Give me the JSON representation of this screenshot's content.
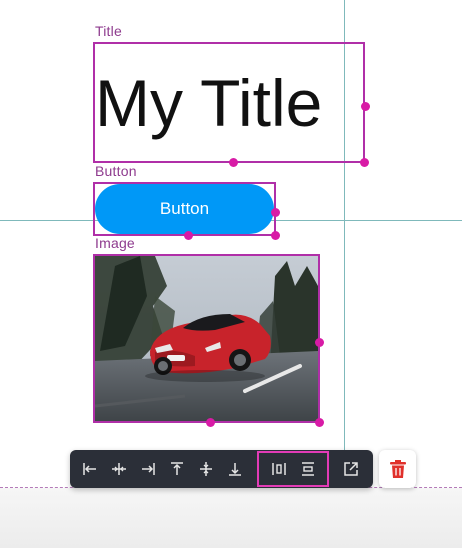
{
  "elements": {
    "title": {
      "label": "Title",
      "text": "My Title"
    },
    "button": {
      "label": "Button",
      "text": "Button"
    },
    "image": {
      "label": "Image",
      "subject": "red sports car on road"
    }
  },
  "toolbar": {
    "buttons": [
      {
        "icon": "align-left-icon"
      },
      {
        "icon": "align-horizontal-center-icon"
      },
      {
        "icon": "align-right-icon"
      },
      {
        "icon": "align-top-icon"
      },
      {
        "icon": "align-vertical-center-icon"
      },
      {
        "icon": "align-bottom-icon"
      },
      {
        "icon": "distribute-horizontal-icon"
      },
      {
        "icon": "distribute-vertical-icon"
      },
      {
        "icon": "open-external-icon"
      }
    ],
    "delete": {
      "icon": "trash-icon"
    }
  },
  "colors": {
    "selection": "#b02fa8",
    "handle": "#d81ba6",
    "guide": "#7fb9bb",
    "button_bg": "#0098f7",
    "toolbar_bg": "#2b2f38",
    "delete_icon": "#e0302b"
  }
}
